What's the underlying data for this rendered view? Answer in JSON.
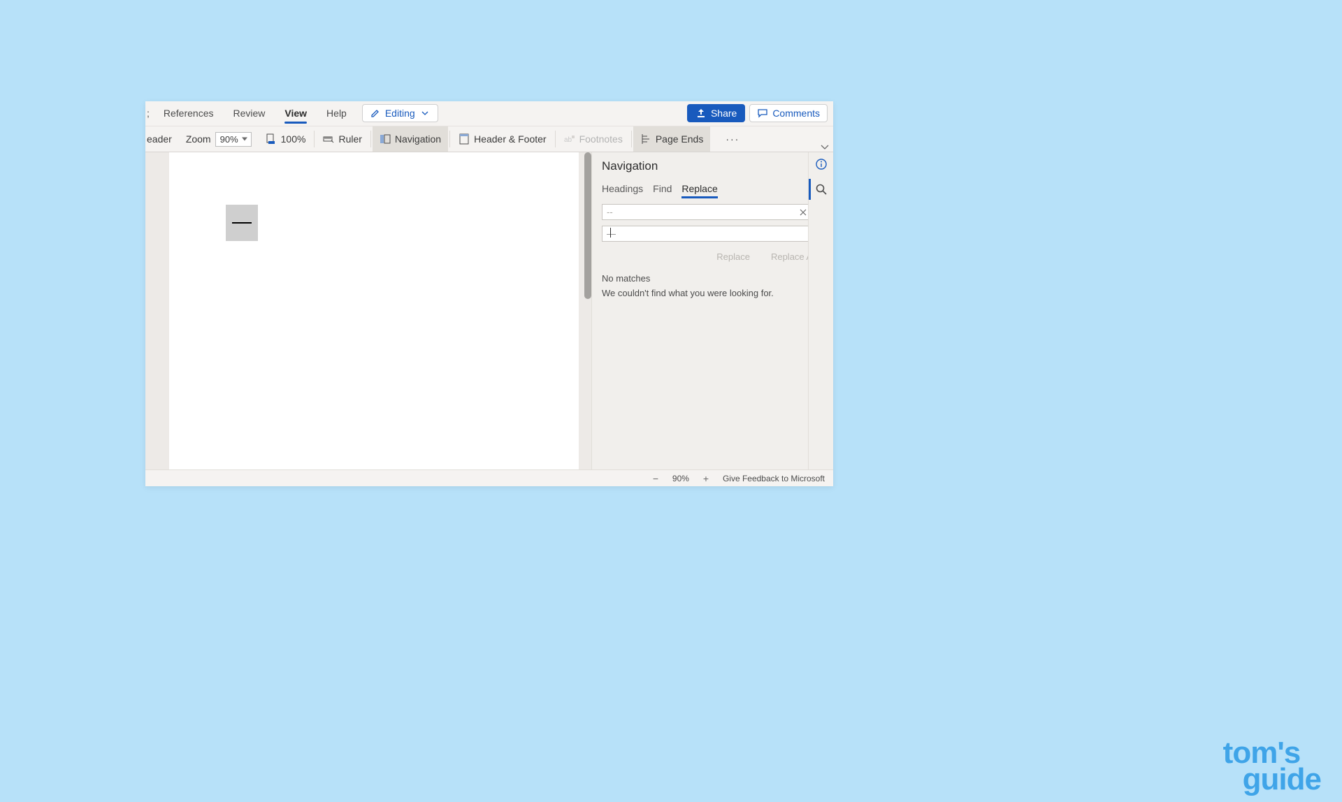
{
  "tabs": {
    "cutoff": "eader",
    "references": "References",
    "review": "Review",
    "view": "View",
    "help": "Help"
  },
  "header_buttons": {
    "editing": "Editing",
    "share": "Share",
    "comments": "Comments"
  },
  "ribbon": {
    "reader_cut": "eader",
    "zoom_label": "Zoom",
    "zoom_value": "90%",
    "hundred": "100%",
    "ruler": "Ruler",
    "navigation": "Navigation",
    "header_footer": "Header & Footer",
    "footnotes": "Footnotes",
    "page_ends": "Page Ends",
    "more": "···"
  },
  "nav_panel": {
    "title": "Navigation",
    "tabs": {
      "headings": "Headings",
      "find": "Find",
      "replace": "Replace"
    },
    "find_value": "--",
    "replace_value": "—",
    "replace_btn": "Replace",
    "replace_all_btn": "Replace All",
    "result_title": "No matches",
    "result_msg": "We couldn't find what you were looking for."
  },
  "status": {
    "zoom": "90%",
    "feedback": "Give Feedback to Microsoft"
  },
  "watermark": {
    "l1": "tom's",
    "l2": "guide"
  }
}
